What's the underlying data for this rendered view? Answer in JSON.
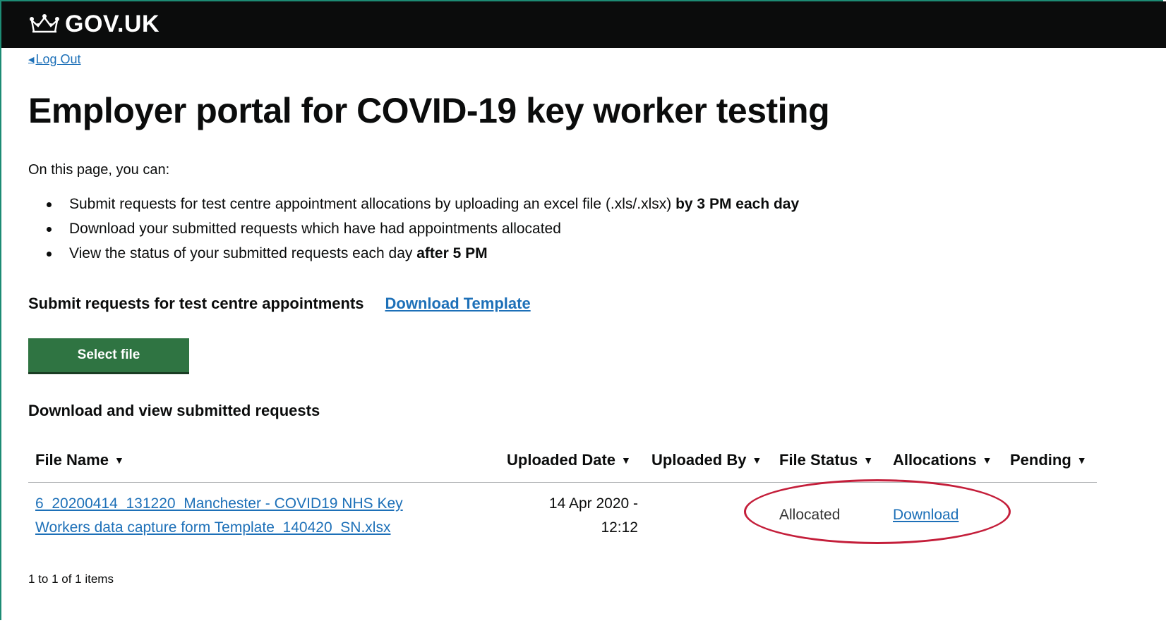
{
  "header": {
    "logo_text": "GOV.UK",
    "icon": "crown-icon"
  },
  "nav": {
    "back_link": "Log Out"
  },
  "page": {
    "title": "Employer portal for COVID-19 key worker testing",
    "intro": "On this page, you can:",
    "bullets": [
      {
        "text": "Submit requests for test centre appointment allocations by uploading an excel file (.xls/.xlsx) ",
        "bold": "by 3 PM each day"
      },
      {
        "text": "Download your submitted requests which have had appointments allocated",
        "bold": ""
      },
      {
        "text": "View the status of your submitted requests each day ",
        "bold": "after 5 PM"
      }
    ]
  },
  "submit": {
    "label": "Submit requests for test centre appointments",
    "template_link": "Download Template",
    "select_button": "Select file",
    "button_color": "#2f7442"
  },
  "requests": {
    "heading": "Download and view submitted requests",
    "columns": [
      "File Name",
      "Uploaded Date",
      "Uploaded By",
      "File Status",
      "Allocations",
      "Pending"
    ],
    "rows": [
      {
        "file_name_line1": "6_20200414_131220_Manchester - COVID19 NHS Key",
        "file_name_line2": "Workers data capture form Template_140420_SN.xlsx",
        "uploaded_date_line1": "14 Apr 2020 -",
        "uploaded_date_line2": "12:12",
        "uploaded_by": "",
        "status": "Allocated",
        "allocations": "Download",
        "pending": ""
      }
    ],
    "count_text": "1 to 1 of 1 items"
  },
  "colors": {
    "header_bg": "#0b0c0c",
    "link": "#1d70b8",
    "highlight": "#c41e3a"
  }
}
